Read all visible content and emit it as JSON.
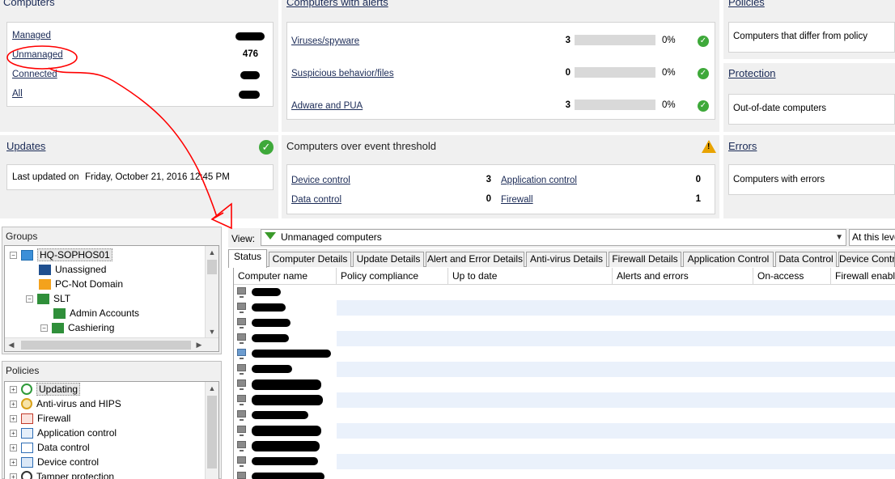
{
  "computers": {
    "title": "Computers",
    "managed_label": "Managed",
    "unmanaged_label": "Unmanaged",
    "unmanaged_count": "476",
    "connected_label": "Connected",
    "all_label": "All"
  },
  "alerts": {
    "title": "Computers with alerts",
    "rows": [
      {
        "label": "Viruses/spyware",
        "count": "3",
        "percent": "0%",
        "fraction": 0
      },
      {
        "label": "Suspicious behavior/files",
        "count": "0",
        "percent": "0%",
        "fraction": 0
      },
      {
        "label": "Adware and PUA",
        "count": "3",
        "percent": "0%",
        "fraction": 0
      }
    ]
  },
  "policies_panel": {
    "title": "Policies",
    "item": "Computers that differ from policy"
  },
  "protection_panel": {
    "title": "Protection",
    "item": "Out-of-date computers"
  },
  "updates": {
    "title": "Updates",
    "last_updated_label": "Last updated on",
    "last_updated_value": "Friday, October 21, 2016 12:45 PM"
  },
  "threshold": {
    "title": "Computers over event threshold",
    "device_control_label": "Device control",
    "device_control_count": "3",
    "data_control_label": "Data control",
    "data_control_count": "0",
    "application_control_label": "Application control",
    "application_control_count": "0",
    "firewall_label": "Firewall",
    "firewall_count": "1"
  },
  "errors_panel": {
    "title": "Errors",
    "item": "Computers with errors"
  },
  "groups": {
    "title": "Groups",
    "items": [
      "HQ-SOPHOS01",
      "Unassigned",
      "PC-Not Domain",
      "SLT",
      "Admin Accounts",
      "Cashiering"
    ]
  },
  "policies": {
    "title": "Policies",
    "items": [
      "Updating",
      "Anti-virus and HIPS",
      "Firewall",
      "Application control",
      "Data control",
      "Device control",
      "Tamper protection"
    ]
  },
  "view": {
    "label": "View:",
    "selected": "Unmanaged computers",
    "level": "At this level"
  },
  "tabs": [
    "Status",
    "Computer Details",
    "Update Details",
    "Alert and Error Details",
    "Anti-virus Details",
    "Firewall Details",
    "Application Control",
    "Data Control",
    "Device Control"
  ],
  "columns": [
    "Computer name",
    "Policy compliance",
    "Up to date",
    "Alerts and errors",
    "On-access",
    "Firewall enabled"
  ],
  "colors": {
    "panel_bg": "#f0f0f0",
    "link": "#1a2a56",
    "ok_green": "#3ea93a",
    "warning": "#e8a300",
    "row_alt": "#eaf1fb",
    "annotation_red": "#ff0000"
  },
  "icons": {
    "ok": "check-circle-icon",
    "warning": "warning-triangle-icon",
    "filter": "filter-icon",
    "computer": "computer-icon"
  }
}
